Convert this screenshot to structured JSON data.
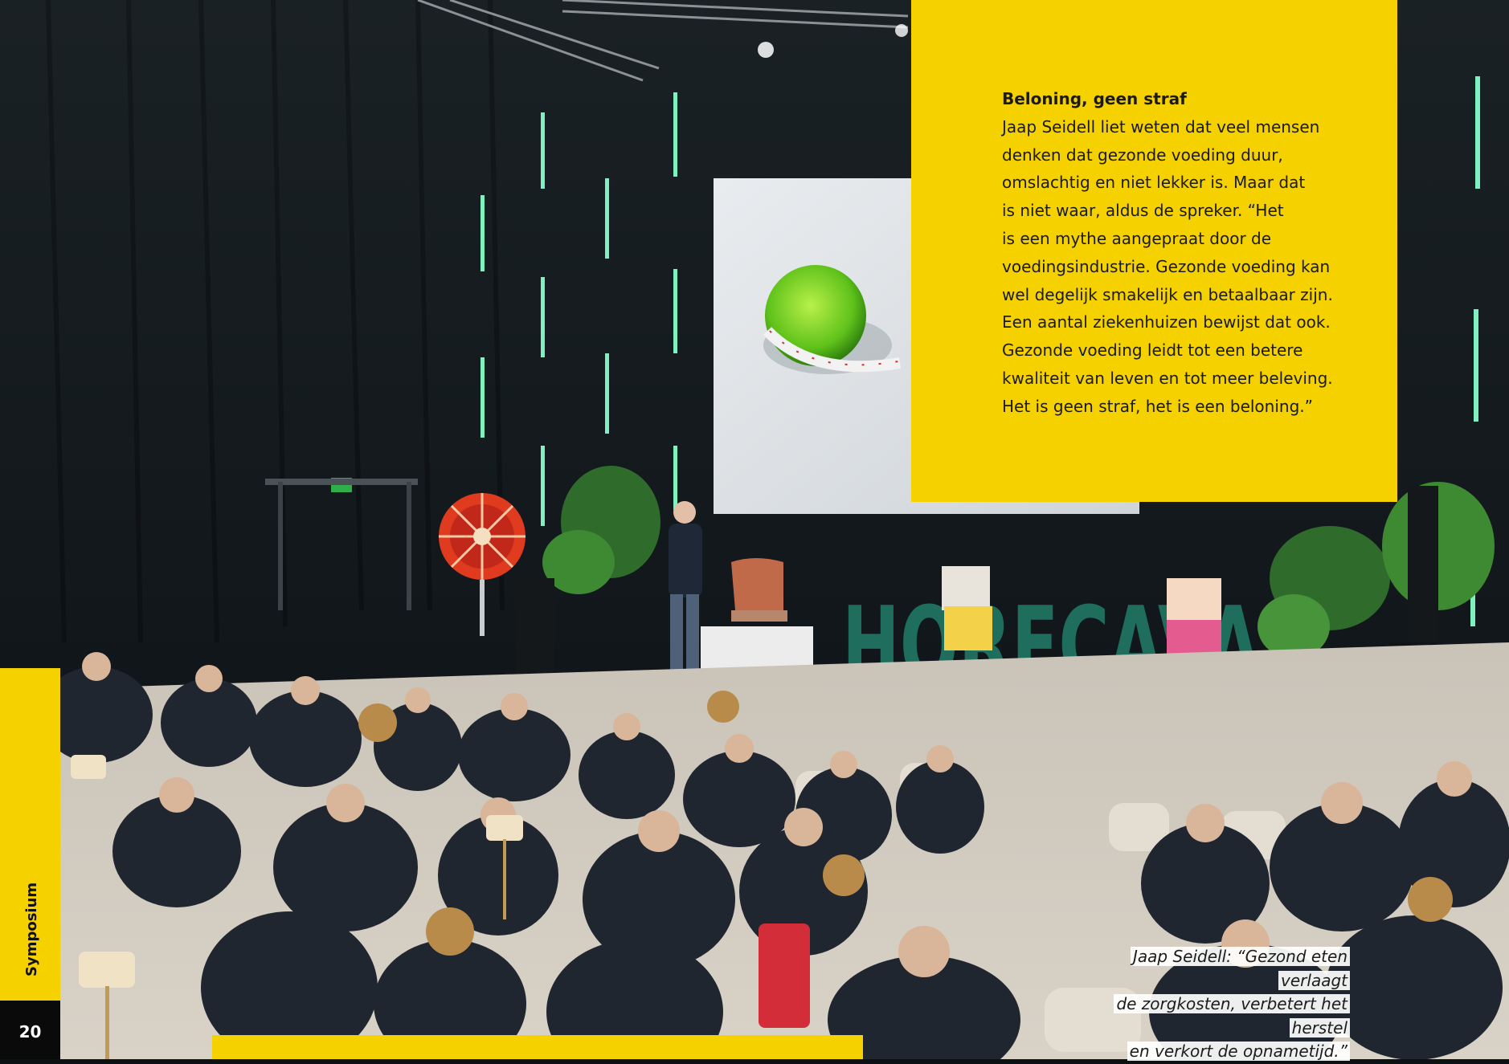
{
  "quote_box": {
    "heading": "Beloning, geen straf",
    "lines": [
      "Jaap Seidell liet weten dat veel mensen",
      "denken dat gezonde voeding duur,",
      "omslachtig en niet lekker is. Maar dat",
      "is niet waar, aldus de spreker. “Het",
      "is een mythe aangepraat door de",
      "voedingsindustrie. Gezonde voeding kan",
      "wel degelijk smakelijk en betaalbaar zijn.",
      "Een aantal ziekenhuizen bewijst dat ook.",
      "Gezonde voeding leidt tot een betere",
      "kwaliteit van leven en tot meer beleving.",
      "Het is geen straf, het is een beloning.”"
    ]
  },
  "section_label": "Symposium",
  "page_number": "20",
  "caption": {
    "lines": [
      "Jaap Seidell: “Gezond eten verlaagt",
      "de zorgkosten, verbetert het herstel",
      "en verkort de opnametijd.”"
    ]
  },
  "stage_sign": "HORECAVA",
  "colors": {
    "accent_yellow": "#f6d100",
    "dark": "#0c1114",
    "green_light": "#7ff0c0",
    "sign_green": "#1f6d5c"
  }
}
